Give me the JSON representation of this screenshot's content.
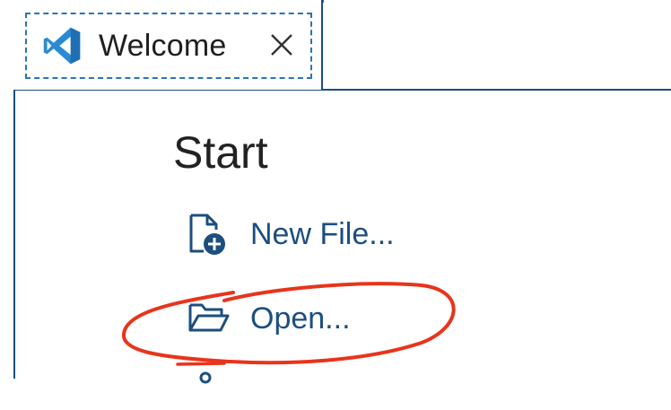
{
  "tab": {
    "label": "Welcome",
    "icon": "vscode-logo-icon",
    "close_icon": "close-icon"
  },
  "start": {
    "title": "Start",
    "items": [
      {
        "label": "New File...",
        "icon": "new-file-icon"
      },
      {
        "label": "Open...",
        "icon": "folder-open-icon"
      },
      {
        "label": "",
        "icon": "clone-repo-icon"
      }
    ]
  },
  "colors": {
    "link": "#1c4e80",
    "frame": "#1c4e80",
    "accent_top": "#b3372b",
    "annotation": "#e8341c",
    "vscode_blue": "#2a8ad4"
  }
}
